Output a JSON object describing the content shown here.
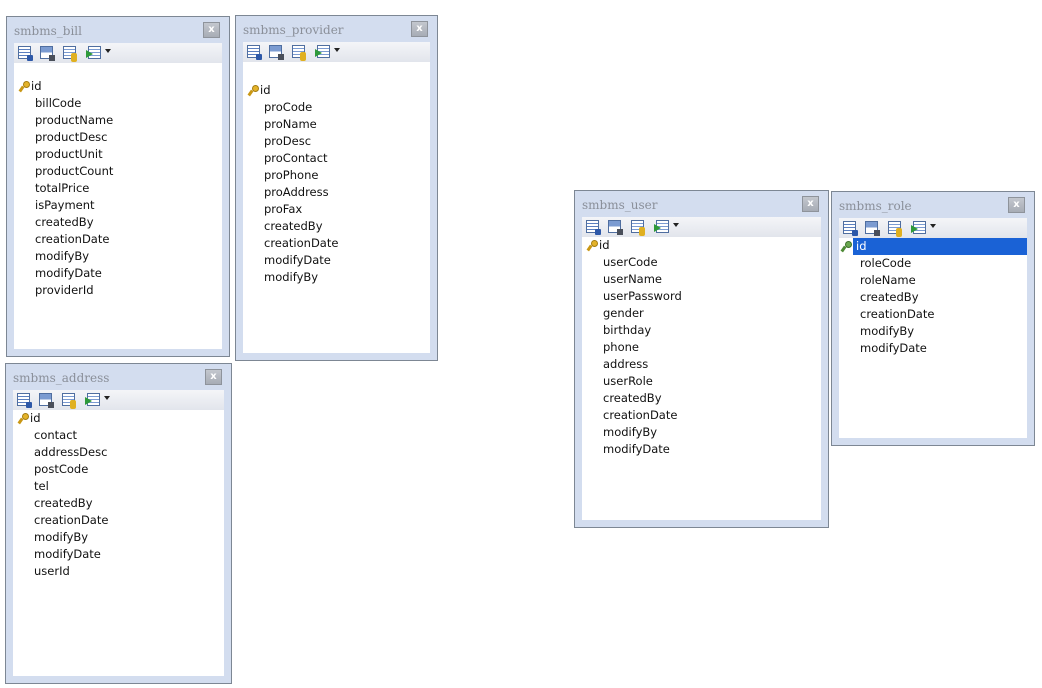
{
  "tables": [
    {
      "title": "smbms_bill",
      "close_label": "x",
      "primary_key": "id",
      "fields": [
        "billCode",
        "productName",
        "productDesc",
        "productUnit",
        "productCount",
        "totalPrice",
        "isPayment",
        "createdBy",
        "creationDate",
        "modifyBy",
        "modifyDate",
        "providerId"
      ]
    },
    {
      "title": "smbms_provider",
      "close_label": "x",
      "primary_key": "id",
      "fields": [
        "proCode",
        "proName",
        "proDesc",
        "proContact",
        "proPhone",
        "proAddress",
        "proFax",
        "createdBy",
        "creationDate",
        "modifyDate",
        "modifyBy"
      ]
    },
    {
      "title": "smbms_address",
      "close_label": "x",
      "primary_key": "id",
      "fields": [
        "contact",
        "addressDesc",
        "postCode",
        "tel",
        "createdBy",
        "creationDate",
        "modifyBy",
        "modifyDate",
        "userId"
      ]
    },
    {
      "title": "smbms_user",
      "close_label": "x",
      "primary_key": "id",
      "fields": [
        "userCode",
        "userName",
        "userPassword",
        "gender",
        "birthday",
        "phone",
        "address",
        "userRole",
        "createdBy",
        "creationDate",
        "modifyBy",
        "modifyDate"
      ]
    },
    {
      "title": "smbms_role",
      "close_label": "x",
      "primary_key": "id",
      "primary_key_selected": true,
      "fields": [
        "roleCode",
        "roleName",
        "createdBy",
        "creationDate",
        "modifyBy",
        "modifyDate"
      ]
    }
  ],
  "toolbar_icons": [
    "grid-edit-icon",
    "save-icon",
    "key-table-icon",
    "import-icon",
    "dropdown-arrow-icon"
  ]
}
